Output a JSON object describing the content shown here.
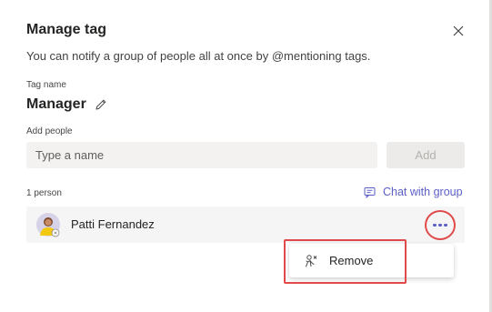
{
  "dialog": {
    "title": "Manage tag",
    "subtitle": "You can notify a group of people all at once by @mentioning tags.",
    "close_icon": "close-icon"
  },
  "tag": {
    "label": "Tag name",
    "name": "Manager",
    "edit_icon": "pencil-icon"
  },
  "add_people": {
    "label": "Add people",
    "input_value": "",
    "placeholder": "Type a name",
    "add_button": "Add"
  },
  "members": {
    "count_label": "1 person",
    "chat_with_group": "Chat with group",
    "chat_icon": "chat-icon",
    "list": [
      {
        "name": "Patti Fernandez",
        "more_icon": "more-options-icon"
      }
    ]
  },
  "context_menu": {
    "items": [
      {
        "label": "Remove",
        "icon": "remove-person-icon"
      }
    ]
  },
  "colors": {
    "accent": "#5b5fc7",
    "highlight": "#e04a4a",
    "row_bg": "#f5f5f5",
    "input_bg": "#f3f2f1"
  }
}
